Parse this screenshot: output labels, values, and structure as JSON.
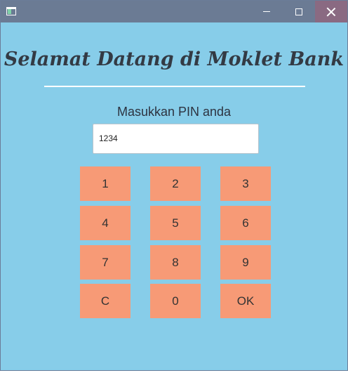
{
  "window": {
    "controls": {
      "minimize": "minimize-icon",
      "maximize": "maximize-icon",
      "close": "close-icon"
    }
  },
  "heading": "Selamat Datang di Moklet Bank",
  "pin": {
    "label": "Masukkan PIN anda",
    "value": "1234"
  },
  "keypad": [
    [
      "1",
      "2",
      "3"
    ],
    [
      "4",
      "5",
      "6"
    ],
    [
      "7",
      "8",
      "9"
    ],
    [
      "C",
      "0",
      "OK"
    ]
  ],
  "colors": {
    "background": "#87cde9",
    "titlebar": "#6b7b94",
    "key": "#f79a76",
    "text": "#333a44"
  }
}
